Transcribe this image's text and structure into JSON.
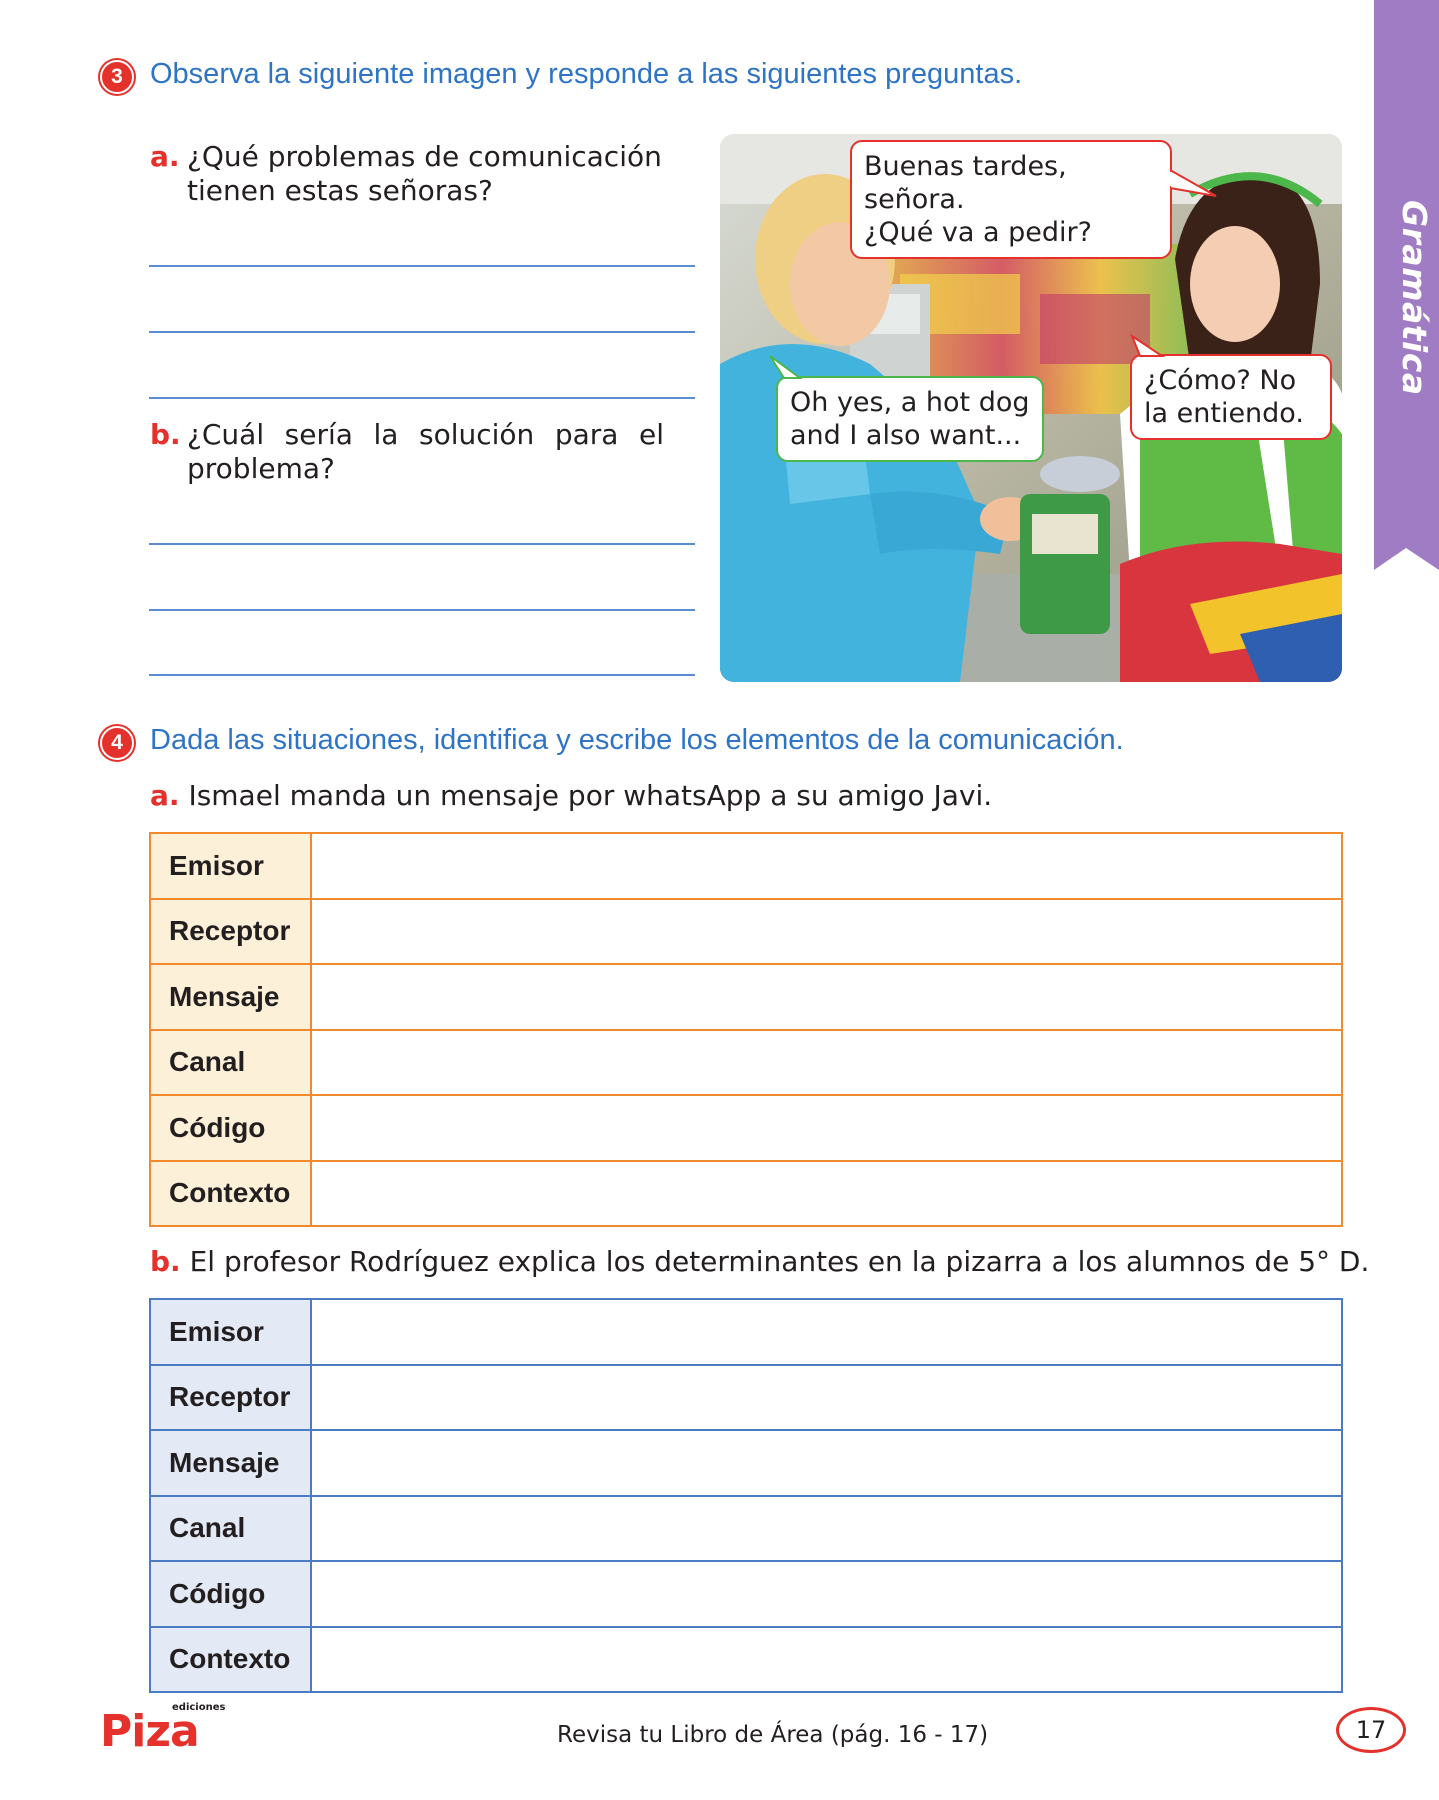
{
  "side_tab": {
    "label": "Gramática",
    "color": "#a07cc5"
  },
  "exercise3": {
    "number": "3",
    "heading": "Observa la siguiente imagen y responde a las siguientes preguntas.",
    "question_a": {
      "letter": "a.",
      "line1": "¿Qué problemas de comunicación",
      "line2": "tienen estas señoras?"
    },
    "question_b": {
      "letter": "b.",
      "line1": "¿Cuál sería la solución para el",
      "line2": "problema?"
    },
    "image": {
      "bubble_cashier_greeting": {
        "line1": "Buenas tardes, señora.",
        "line2": "¿Qué va a pedir?"
      },
      "bubble_customer": {
        "line1": "Oh yes, a hot dog",
        "line2": "and I also want..."
      },
      "bubble_cashier_confused": {
        "line1": "¿Cómo? No",
        "line2": "la entiendo."
      }
    }
  },
  "exercise4": {
    "number": "4",
    "heading": "Dada las situaciones, identifica y escribe los elementos de la comunicación.",
    "situation_a": {
      "letter": "a.",
      "text": "Ismael manda un mensaje por whatsApp a su amigo Javi."
    },
    "situation_b": {
      "letter": "b.",
      "text": "El profesor Rodríguez explica los determinantes en la pizarra a los alumnos de 5° D."
    },
    "rows": [
      "Emisor",
      "Receptor",
      "Mensaje",
      "Canal",
      "Código",
      "Contexto"
    ]
  },
  "footer": {
    "logo_small": "ediciones",
    "logo_main": "Piza",
    "reference": "Revisa tu Libro de Área (pág. 16 - 17)",
    "page_number": "17"
  },
  "colors": {
    "accent_red": "#e4312b",
    "heading_blue": "#2f74c4",
    "table_orange": "#f08a2c",
    "table_blue": "#4a7cc4"
  }
}
